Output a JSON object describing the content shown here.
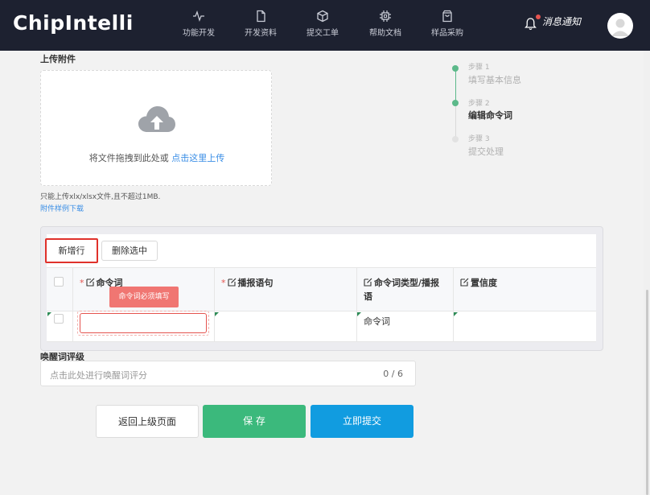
{
  "header": {
    "logo": "ChipIntelli",
    "nav": [
      {
        "label": "功能开发",
        "icon": "activity-icon"
      },
      {
        "label": "开发资料",
        "icon": "document-icon"
      },
      {
        "label": "提交工单",
        "icon": "cube-icon"
      },
      {
        "label": "帮助文档",
        "icon": "chip-icon"
      },
      {
        "label": "样品采购",
        "icon": "shopping-bag-icon"
      }
    ],
    "notice": "消息通知"
  },
  "upload": {
    "title": "上传附件",
    "drop_text": "将文件拖拽到此处或",
    "click_text": "点击这里上传",
    "tip": "只能上传xlx/xlsx文件,且不超过1MB.",
    "sample_link": "附件样例下载"
  },
  "steps": [
    {
      "label": "步骤 1",
      "name": "填写基本信息",
      "state": "done"
    },
    {
      "label": "步骤 2",
      "name": "编辑命令词",
      "state": "active"
    },
    {
      "label": "步骤 3",
      "name": "提交处理",
      "state": "pending"
    }
  ],
  "table": {
    "add_row": "新增行",
    "delete_selected": "删除选中",
    "columns": [
      {
        "label": "命令词",
        "required": true
      },
      {
        "label": "播报语句",
        "required": true
      },
      {
        "label": "命令词类型/播报语",
        "required": false
      },
      {
        "label": "置信度",
        "required": false
      }
    ],
    "required_mark": "*",
    "validation_tip": "命令词必须填写",
    "row": {
      "command": "",
      "broadcast": "",
      "type": "命令词",
      "confidence": ""
    }
  },
  "wake": {
    "title": "唤醒词评级",
    "placeholder": "点击此处进行唤醒词评分",
    "count": "0 / 6"
  },
  "actions": {
    "back": "返回上级页面",
    "save": "保 存",
    "submit": "立即提交"
  },
  "colors": {
    "header_bg": "#1d2130",
    "success": "#3bb97c",
    "primary": "#119ce0",
    "danger": "#e5544f",
    "link": "#3a8ee6"
  }
}
